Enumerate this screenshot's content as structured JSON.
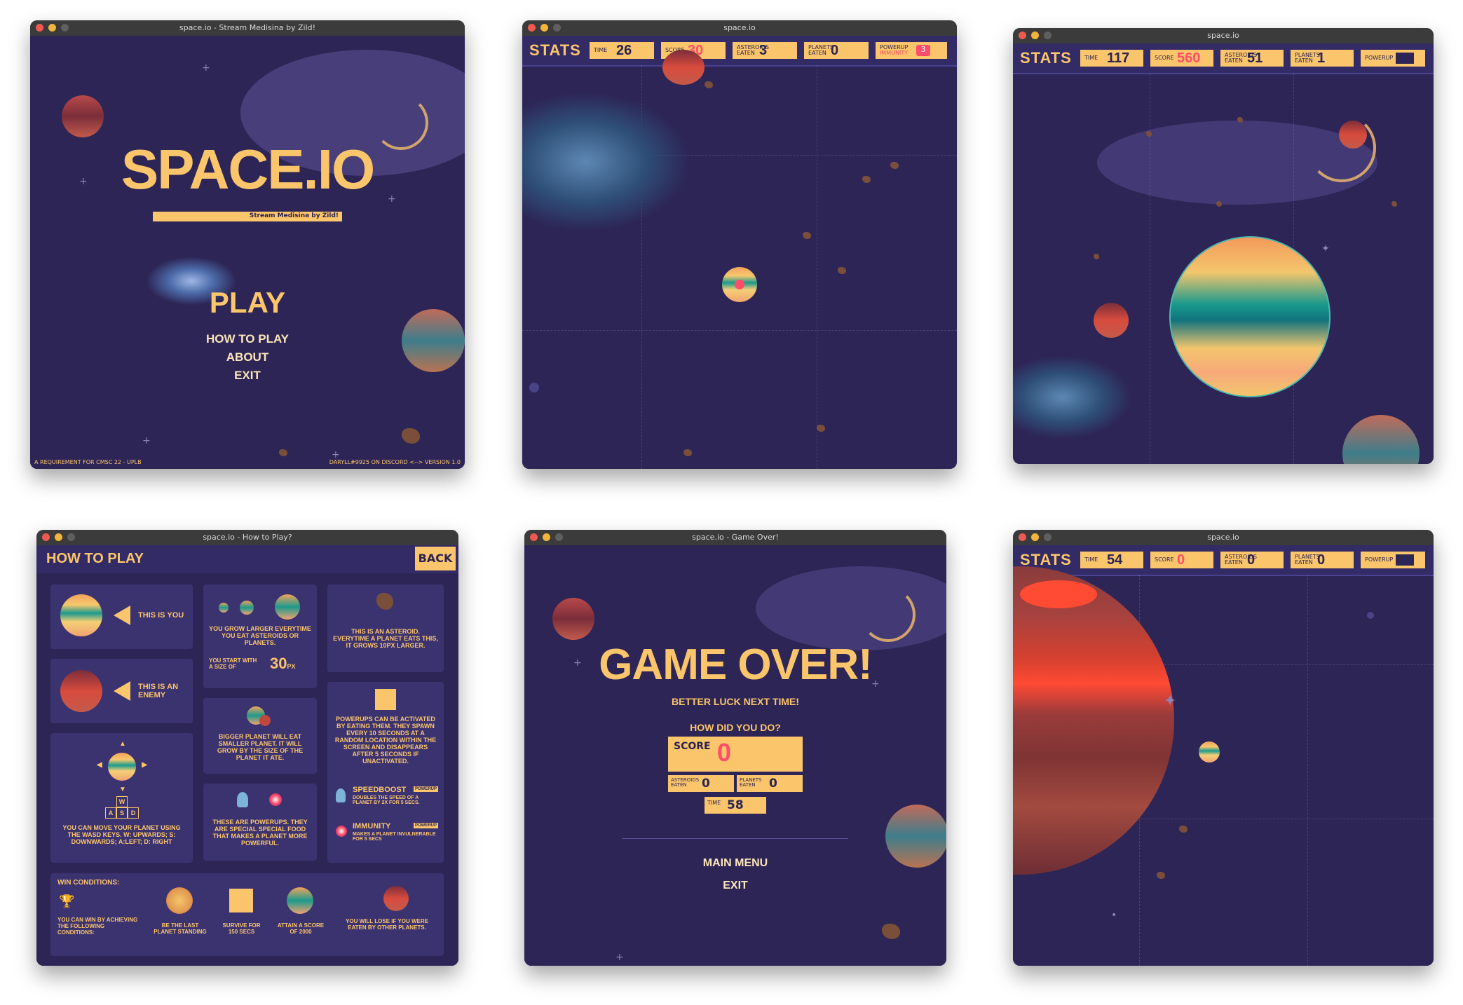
{
  "win1": {
    "title": "space.io - Stream Medisina by Zild!",
    "logo": "SPACE.IO",
    "tagline": "Stream Medisina by Zild!",
    "play": "PLAY",
    "how_to_play": "HOW TO PLAY",
    "about": "ABOUT",
    "exit": "EXIT",
    "footer_left": "A REQUIREMENT FOR CMSC 22 - UPLB",
    "footer_right": "DARYLL#9925 ON DISCORD <--> VERSION 1.0"
  },
  "win2": {
    "title": "space.io",
    "stats_label": "STATS",
    "time_key": "TIME",
    "time": "26",
    "score_key": "SCORE",
    "score": "30",
    "asteroids_key": "ASTEROIDS EATEN",
    "asteroids": "3",
    "planets_key": "PLANETS EATEN",
    "planets": "0",
    "powerup_key": "POWERUP",
    "powerup_name": "IMMUNITY",
    "powerup_count": "3"
  },
  "win3": {
    "title": "space.io",
    "stats_label": "STATS",
    "time_key": "TIME",
    "time": "117",
    "score_key": "SCORE",
    "score": "560",
    "asteroids_key": "ASTEROIDS EATEN",
    "asteroids": "51",
    "planets_key": "PLANETS EATEN",
    "planets": "1",
    "powerup_key": "POWERUP"
  },
  "win4": {
    "title": "space.io - How to Play?",
    "header": "HOW TO PLAY",
    "back": "BACK",
    "this_is_you": "THIS IS YOU",
    "this_is_enemy": "THIS IS AN ENEMY",
    "grow_text": "YOU GROW LARGER EVERYTIME YOU EAT ASTEROIDS OR PLANETS.",
    "start_text": "YOU START WITH A SIZE OF",
    "start_size": "30",
    "start_unit": "PX",
    "asteroid_text": "THIS IS AN ASTEROID. EVERYTIME A PLANET EATS THIS, IT GROWS 10PX LARGER.",
    "bigger_text": "BIGGER PLANET WILL EAT SMALLER PLANET. IT WILL GROW BY THE SIZE OF THE PLANET IT ATE.",
    "powerup_spawn_text": "POWERUPS CAN BE ACTIVATED BY EATING THEM. THEY SPAWN EVERY 10 SECONDS AT A RANDOM LOCATION WITHIN THE SCREEN AND DISAPPEARS AFTER 5 SECONDS IF UNACTIVATED.",
    "move_text": "YOU CAN MOVE YOUR PLANET USING THE WASD KEYS. W: UPWARDS; S: DOWNWARDS; A:LEFT; D: RIGHT",
    "key_w": "W",
    "key_a": "A",
    "key_s": "S",
    "key_d": "D",
    "powerups_text": "THESE ARE POWERUPS. THEY ARE SPECIAL SPECIAL FOOD THAT MAKES A PLANET MORE POWERFUL.",
    "speedboost_title": "SPEEDBOOST",
    "speedboost_tag": "POWERUP",
    "speedboost_text": "DOUBLES THE SPEED OF A PLANET BY 2X FOR 5 SECS.",
    "immunity_title": "IMMUNITY",
    "immunity_tag": "POWERUP",
    "immunity_text": "MAKES A PLANET INVULNERABLE FOR 5 SECS",
    "win_title": "WIN CONDITIONS:",
    "win_text": "YOU CAN WIN BY ACHIEVING THE FOLLOWING CONDITIONS:",
    "cond1": "BE THE LAST PLANET STANDING",
    "cond2": "SURVIVE FOR 150 SECS",
    "cond3": "ATTAIN A SCORE OF 2000",
    "lose_text": "YOU WILL LOSE IF YOU WERE EATEN BY OTHER PLANETS."
  },
  "win5": {
    "title": "space.io - Game Over!",
    "heading": "GAME OVER!",
    "sub": "BETTER LUCK NEXT TIME!",
    "question": "HOW DID YOU DO?",
    "score_key": "SCORE",
    "score": "0",
    "asteroids_key": "ASTEROIDS EATEN",
    "asteroids": "0",
    "planets_key": "PLANETS EATEN",
    "planets": "0",
    "time_key": "TIME",
    "time": "58",
    "main_menu": "MAIN MENU",
    "exit": "EXIT"
  },
  "win6": {
    "title": "space.io",
    "stats_label": "STATS",
    "time_key": "TIME",
    "time": "54",
    "score_key": "SCORE",
    "score": "0",
    "asteroids_key": "ASTEROIDS EATEN",
    "asteroids": "0",
    "planets_key": "PLANETS EATEN",
    "planets": "0",
    "powerup_key": "POWERUP"
  },
  "colors": {
    "gold": "#fbc56b",
    "space": "#2d2556",
    "score_red": "#ff4d6a"
  }
}
